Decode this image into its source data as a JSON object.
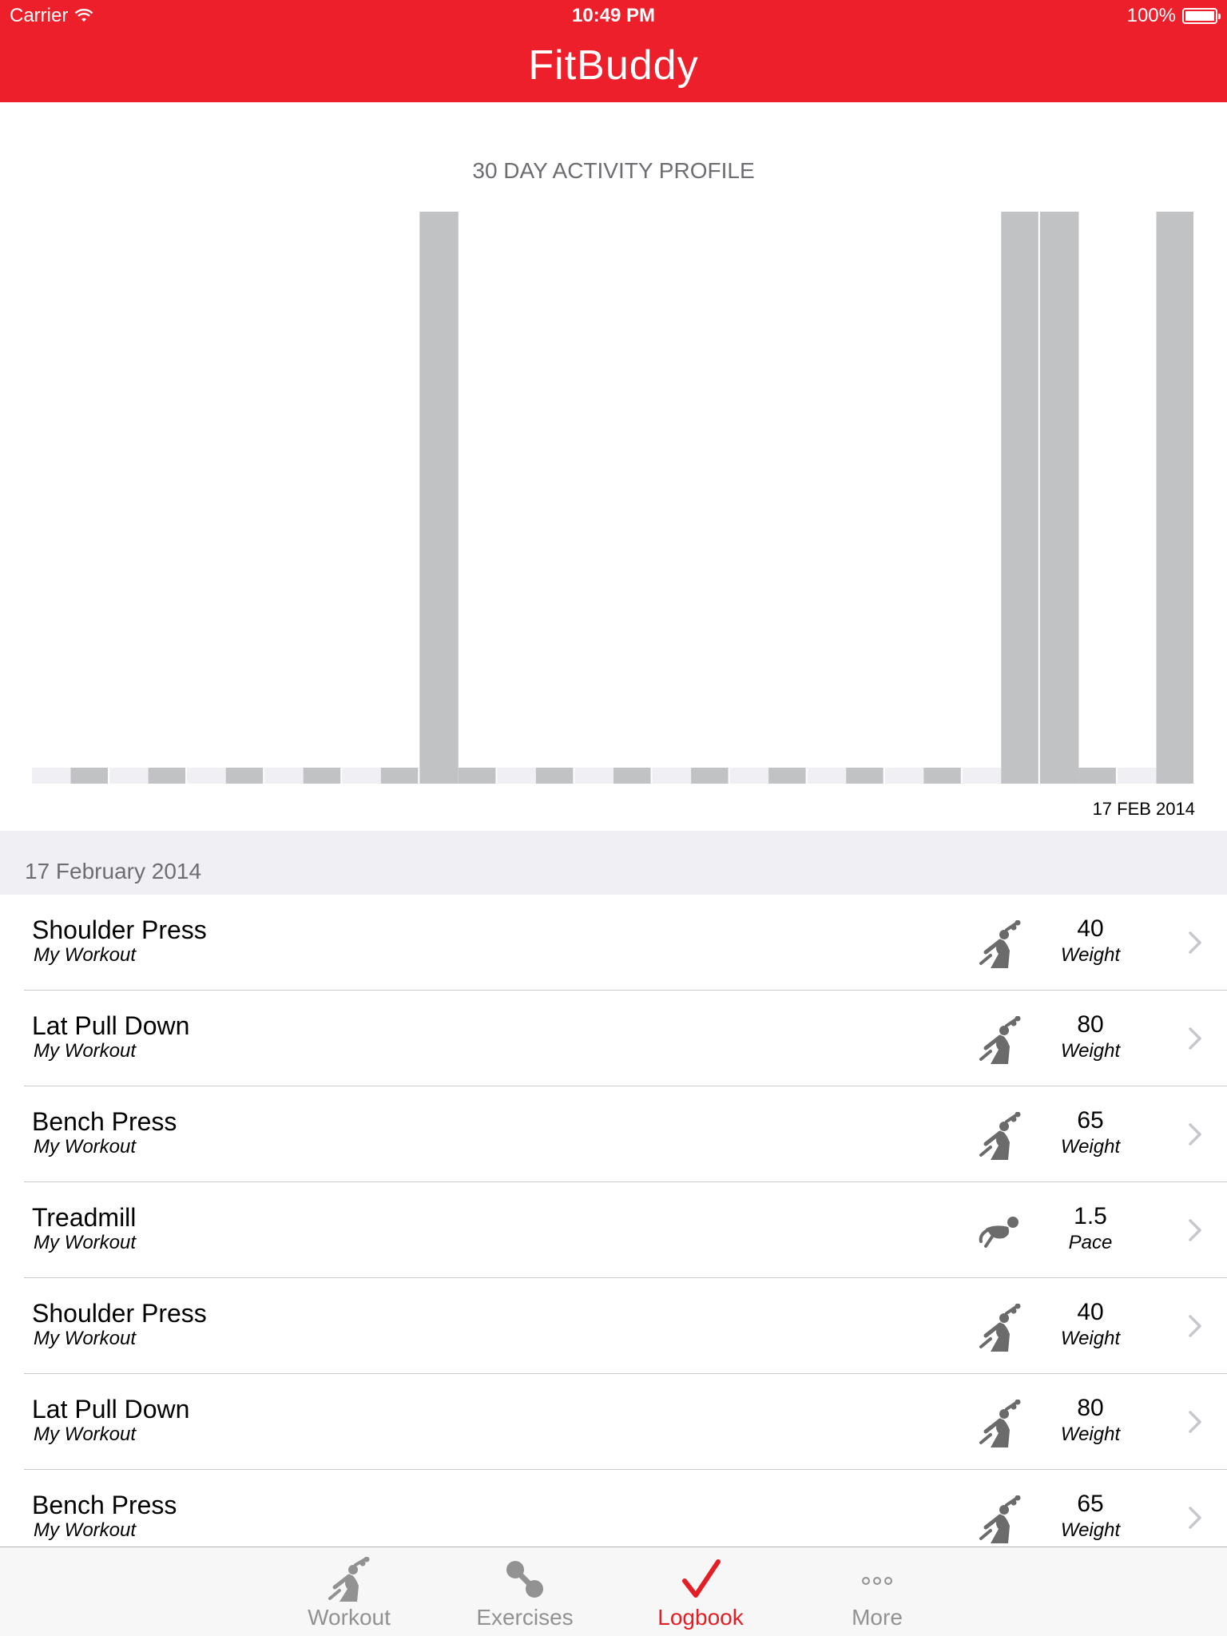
{
  "status": {
    "carrier": "Carrier",
    "time": "10:49 PM",
    "battery": "100%"
  },
  "header": {
    "title": "FitBuddy"
  },
  "chart_data": {
    "type": "bar",
    "title": "30 DAY ACTIVITY PROFILE",
    "x_end_label": "17 FEB 2014",
    "values": [
      0,
      0,
      0,
      0,
      0,
      0,
      0,
      0,
      0,
      0,
      1,
      0,
      0,
      0,
      0,
      0,
      0,
      0,
      0,
      0,
      0,
      0,
      0,
      0,
      0,
      1,
      1,
      0,
      0,
      1
    ],
    "ylim": [
      0,
      1
    ],
    "colors": {
      "even": "#efeff4",
      "odd": "#c1c2c4",
      "highlight": "#efeff4"
    }
  },
  "section": {
    "label": "17 February 2014"
  },
  "entries": [
    {
      "name": "Shoulder Press",
      "workout": "My Workout",
      "icon": "weight-lifter-icon",
      "value": "40",
      "unit": "Weight"
    },
    {
      "name": "Lat Pull Down",
      "workout": "My Workout",
      "icon": "weight-lifter-icon",
      "value": "80",
      "unit": "Weight"
    },
    {
      "name": "Bench Press",
      "workout": "My Workout",
      "icon": "weight-lifter-icon",
      "value": "65",
      "unit": "Weight"
    },
    {
      "name": "Treadmill",
      "workout": "My Workout",
      "icon": "runner-icon",
      "value": "1.5",
      "unit": "Pace"
    },
    {
      "name": "Shoulder Press",
      "workout": "My Workout",
      "icon": "weight-lifter-icon",
      "value": "40",
      "unit": "Weight"
    },
    {
      "name": "Lat Pull Down",
      "workout": "My Workout",
      "icon": "weight-lifter-icon",
      "value": "80",
      "unit": "Weight"
    },
    {
      "name": "Bench Press",
      "workout": "My Workout",
      "icon": "weight-lifter-icon",
      "value": "65",
      "unit": "Weight"
    }
  ],
  "tabs": [
    {
      "label": "Workout",
      "icon": "workout-icon",
      "active": false
    },
    {
      "label": "Exercises",
      "icon": "dumbbell-icon",
      "active": false
    },
    {
      "label": "Logbook",
      "icon": "checkmark-icon",
      "active": true
    },
    {
      "label": "More",
      "icon": "more-icon",
      "active": false
    }
  ],
  "colors": {
    "brand": "#ec1f2a",
    "active_tab": "#e31e24",
    "inactive_tab": "#929292"
  }
}
